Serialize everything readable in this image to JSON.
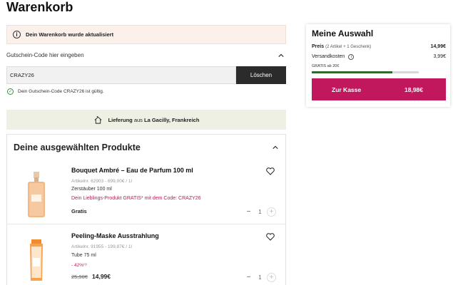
{
  "page": {
    "title": "Warenkorb"
  },
  "banner": {
    "icon": "info-icon",
    "text": "Dein Warenkorb wurde aktualisiert"
  },
  "coupon": {
    "label": "Gutschein-Code hier eingeben",
    "value": "CRAZY26",
    "button_label": "Löschen",
    "valid_text": "Dein Gutschein-Code CRAZY26 ist gültig."
  },
  "delivery": {
    "prefix": "Lieferung",
    "middle": "aus",
    "location": "La Gacilly, Frankreich"
  },
  "products": {
    "title": "Deine ausgewählten Produkte",
    "items": [
      {
        "name": "Bouquet Ambré – Eau de Parfum 100 ml",
        "article": "Artikelnr. 62903 - 699,00€ / 1l",
        "size": "Zerstäuber 100 ml",
        "promo": "Dein Lieblings-Produkt GRATIS* mit dem Code: CRAZY26",
        "price": "Gratis",
        "quantity": "1"
      },
      {
        "name": "Peeling-Maske Ausstrahlung",
        "article": "Artikelnr. 91955 - 199,87€ / 1l",
        "size": "Tube 75 ml",
        "discount": "- 42%⁽¹⁾",
        "old_price": "25,90€",
        "price": "14,99€",
        "quantity": "1"
      }
    ]
  },
  "summary": {
    "title": "Meine Auswahl",
    "price_label": "Preis",
    "price_detail": "(2 Artikel + 1 Geschenk)",
    "price_value": "14,99€",
    "shipping_label": "Versandkosten",
    "shipping_value": "3,99€",
    "free_note": "GRATIS ab 20€",
    "progress_fraction": 0.75,
    "checkout_label": "Zur Kasse",
    "checkout_total": "18,98€"
  },
  "colors": {
    "accent": "#c0175d",
    "dark_button": "#2b2b2b",
    "progress": "#2f6b2f",
    "banner_bg": "#fbf1ea",
    "delivery_bg": "#eef0e4"
  }
}
